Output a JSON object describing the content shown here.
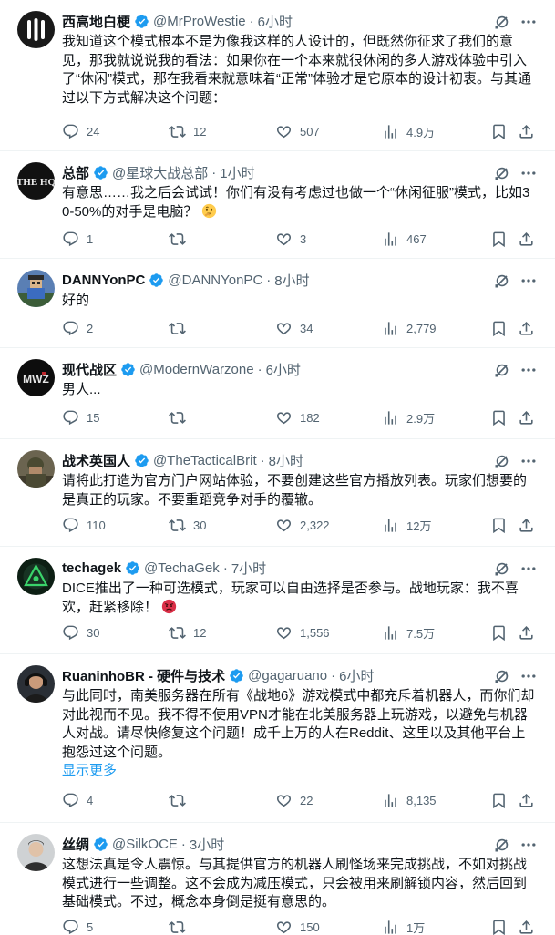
{
  "tweets": [
    {
      "name": "西高地白梗",
      "handle": "@MrProWestie",
      "time": "6小时",
      "text": "我知道这个模式根本不是为像我这样的人设计的，但既然你征求了我们的意见，那我就说说我的看法：如果你在一个本来就很休闲的多人游戏体验中引入了“休闲”模式，那在我看来就意味着“正常”体验才是它原本的设计初衷。与其通过以下方式解决这个问题：",
      "replies": "24",
      "retweets": "12",
      "likes": "507",
      "views": "4.9万",
      "avatar_icon": "white-bars-logo-icon"
    },
    {
      "name": "总部",
      "handle": "@星球大战总部",
      "time": "1小时",
      "text": "有意思……我之后会试试！你们有没有考虑过也做一个“休闲征服”模式，比如30-50%的对手是电脑？",
      "emoji": "thinking-face-emoji",
      "replies": "1",
      "retweets": "",
      "likes": "3",
      "views": "467",
      "avatar_icon": "the-hq-logo-icon",
      "avatar_text": "THE HQ"
    },
    {
      "name": "DANNYonPC",
      "handle": "@DANNYonPC",
      "time": "8小时",
      "text": "好的",
      "replies": "2",
      "retweets": "",
      "likes": "34",
      "views": "2,779",
      "avatar_icon": "pixel-character-icon"
    },
    {
      "name": "现代战区",
      "handle": "@ModernWarzone",
      "time": "6小时",
      "text": "男人...",
      "replies": "15",
      "retweets": "",
      "likes": "182",
      "views": "2.9万",
      "avatar_icon": "mwz-logo-icon",
      "avatar_text": "MWZ"
    },
    {
      "name": "战术英国人",
      "handle": "@TheTacticalBrit",
      "time": "8小时",
      "text": "请将此打造为官方门户网站体验，不要创建这些官方播放列表。玩家们想要的是真正的玩家。不要重蹈竞争对手的覆辙。",
      "replies": "110",
      "retweets": "30",
      "likes": "2,322",
      "views": "12万",
      "avatar_icon": "soldier-photo-icon"
    },
    {
      "name": "techagek",
      "handle": "@TechaGek",
      "time": "7小时",
      "text": "DICE推出了一种可选模式，玩家可以自由选择是否参与。战地玩家：我不喜欢，赶紧移除！",
      "emoji": "angry-face-emoji",
      "replies": "30",
      "retweets": "12",
      "likes": "1,556",
      "views": "7.5万",
      "avatar_icon": "green-triangle-logo-icon"
    },
    {
      "name": "RuaninhoBR - 硬件与技术",
      "handle": "@gagaruano",
      "time": "6小时",
      "text": "与此同时，南美服务器在所有《战地6》游戏模式中都充斥着机器人，而你们却对此视而不见。我不得不使用VPN才能在北美服务器上玩游戏，以避免与机器人对战。请尽快修复这个问题！成千上万的人在Reddit、这里以及其他平台上抱怨过这个问题。",
      "show_more": "显示更多",
      "replies": "4",
      "retweets": "",
      "likes": "22",
      "views": "8,135",
      "avatar_icon": "headset-person-icon"
    },
    {
      "name": "丝绸",
      "handle": "@SilkOCE",
      "time": "3小时",
      "text": "这想法真是令人震惊。与其提供官方的机器人刷怪场来完成挑战，不如对挑战模式进行一些调整。这不会成为减压模式，只会被用来刷解锁内容，然后回到基础模式。不过，概念本身倒是挺有意思的。",
      "replies": "5",
      "retweets": "",
      "likes": "150",
      "views": "1万",
      "avatar_icon": "person-photo-icon"
    }
  ],
  "colors": {
    "text": "#0f1419",
    "secondary": "#536471",
    "verified": "#1d9bf0",
    "link": "#1d9bf0",
    "divider": "#eff3f4"
  }
}
